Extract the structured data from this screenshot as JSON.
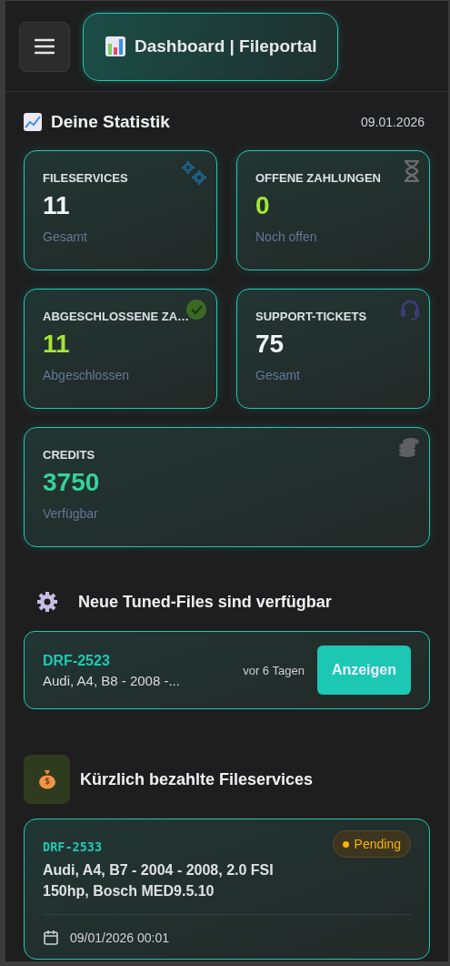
{
  "header": {
    "title": "Dashboard | Fileportal"
  },
  "stats": {
    "title": "Deine Statistik",
    "date": "09.01.2026",
    "cards": [
      {
        "label": "FILESERVICES",
        "value": "11",
        "sub": "Gesamt",
        "color": "#f1f5f9"
      },
      {
        "label": "OFFENE ZAHLUNGEN",
        "value": "0",
        "sub": "Noch offen",
        "color": "#a3e635"
      },
      {
        "label": "ABGESCHLOSSENE ZA…",
        "value": "11",
        "sub": "Abgeschlossen",
        "color": "#a3e635"
      },
      {
        "label": "SUPPORT-TICKETS",
        "value": "75",
        "sub": "Gesamt",
        "color": "#f1f5f9"
      },
      {
        "label": "CREDITS",
        "value": "3750",
        "sub": "Verfügbar",
        "color": "#34d399"
      }
    ]
  },
  "tuned": {
    "title": "Neue Tuned-Files sind verfügbar",
    "items": [
      {
        "id": "DRF-2523",
        "vehicle": "Audi, A4, B8 - 2008 -...",
        "time": "vor 6 Tagen",
        "button": "Anzeigen"
      }
    ]
  },
  "paid": {
    "title": "Kürzlich bezahlte Fileservices",
    "items": [
      {
        "id": "DRF-2533",
        "status": "Pending",
        "vehicle": "Audi, A4, B7 - 2004 - 2008, 2.0 FSI 150hp, Bosch MED9.5.10",
        "date": "09/01/2026 00:01"
      }
    ]
  }
}
